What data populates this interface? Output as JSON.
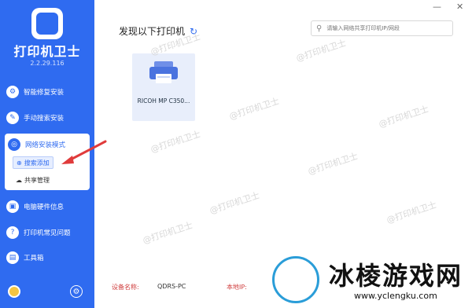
{
  "app": {
    "title": "打印机卫士",
    "version": "2.2.29.116"
  },
  "sidebar": {
    "items": [
      {
        "label": "智能修复安装",
        "icon": "repair-icon"
      },
      {
        "label": "手动搜索安装",
        "icon": "wrench-icon"
      },
      {
        "label": "电脑硬件信息",
        "icon": "hardware-icon"
      },
      {
        "label": "打印机常见问题",
        "icon": "question-icon"
      },
      {
        "label": "工具箱",
        "icon": "toolbox-icon"
      }
    ],
    "network_mode": {
      "label": "网络安装模式",
      "sub_items": [
        {
          "label": "搜索添加",
          "icon": "search-add-icon"
        },
        {
          "label": "共享管理",
          "icon": "cloud-icon"
        }
      ]
    }
  },
  "main": {
    "section_title": "发现以下打印机",
    "search": {
      "placeholder": "请输入网络共享打印机IP/网段"
    },
    "printers": [
      {
        "name": "RICOH MP C350..."
      }
    ],
    "watermark": "@打印机卫士"
  },
  "footer": {
    "device_label": "设备名称:",
    "device_value": "QDRS-PC",
    "ip_label": "本地IP:"
  },
  "brand_overlay": {
    "name": "冰棱游戏网",
    "url": "www.yclengku.com"
  },
  "colors": {
    "accent": "#2f6bf0",
    "sidebar_bg": "#2f6bf0",
    "card_bg": "#e8eefb",
    "arrow": "#e03b3b"
  }
}
